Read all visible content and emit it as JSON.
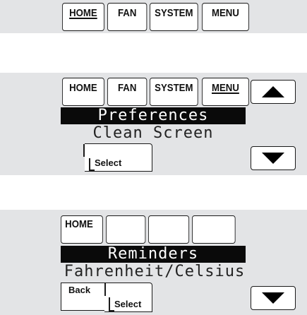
{
  "panels": [
    {
      "softkeys": [
        "HOME",
        "FAN",
        "SYSTEM",
        "MENU"
      ],
      "selected": "HOME"
    },
    {
      "softkeys": [
        "HOME",
        "FAN",
        "SYSTEM",
        "MENU"
      ],
      "selected": "MENU",
      "menu_highlighted": "Preferences",
      "menu_next": "Clean Screen",
      "select_label": "Select",
      "up_icon": "triangle-up-icon",
      "down_icon": "triangle-down-icon"
    },
    {
      "softkeys": [
        "HOME",
        "",
        "",
        ""
      ],
      "selected": "",
      "menu_highlighted": "Reminders",
      "menu_next": "Fahrenheit/Celsius",
      "back_label": "Back",
      "select_label": "Select",
      "down_icon": "triangle-down-icon"
    }
  ],
  "colors": {
    "panel_bg": "#e3e4e6",
    "highlight_bg": "#0a0a0a",
    "outline": "#1a1a1a"
  }
}
